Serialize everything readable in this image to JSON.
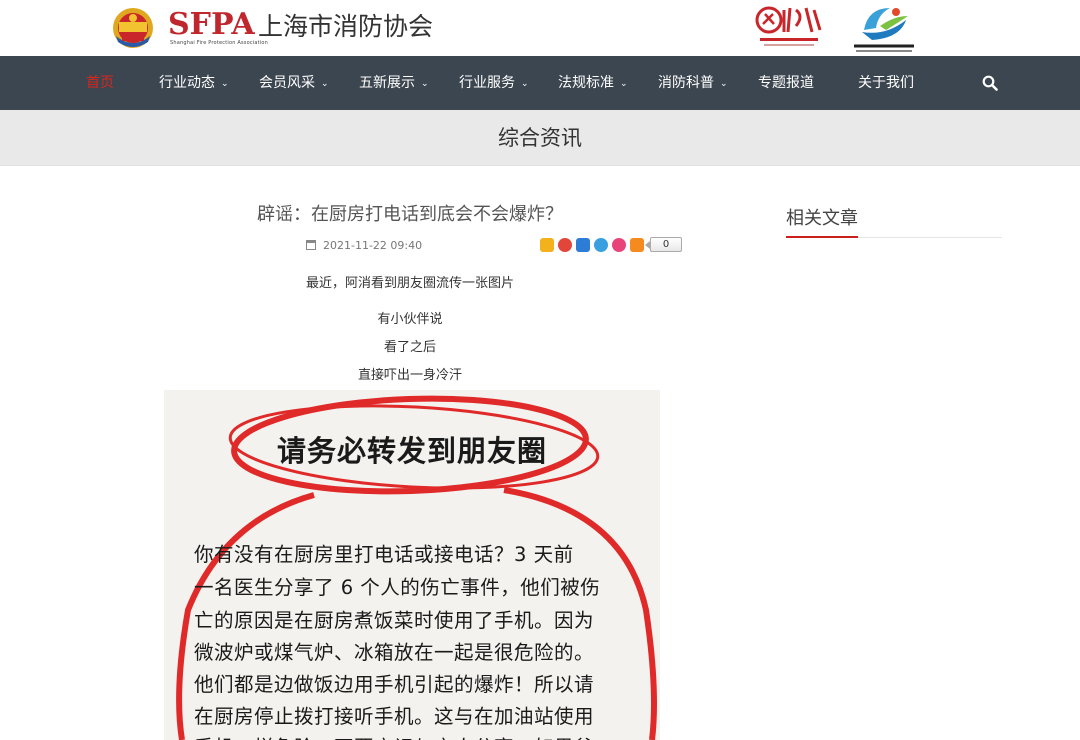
{
  "header": {
    "logo_title": "SFPA",
    "logo_subtitle": "Shanghai Fire Protection Association",
    "logo_cn": "上海市消防协会"
  },
  "nav": {
    "items": [
      {
        "label": "首页",
        "active": true,
        "has_caret": false
      },
      {
        "label": "行业动态",
        "has_caret": true
      },
      {
        "label": "会员风采",
        "has_caret": true
      },
      {
        "label": "五新展示",
        "has_caret": true
      },
      {
        "label": "行业服务",
        "has_caret": true
      },
      {
        "label": "法规标准",
        "has_caret": true
      },
      {
        "label": "消防科普",
        "has_caret": true
      },
      {
        "label": "专题报道",
        "has_caret": false
      },
      {
        "label": "关于我们",
        "has_caret": false
      }
    ],
    "search_icon": "search-icon",
    "active_color": "#d9261c",
    "bar_color": "#3c4650"
  },
  "banner": {
    "title": "综合资讯"
  },
  "article": {
    "title": "辟谣：在厨房打电话到底会不会爆炸？",
    "date": "2021-11-22 09:40",
    "share_count": "0",
    "paragraphs": [
      "最近，阿消看到朋友圈流传一张图片",
      "有小伙伴说",
      "看了之后",
      "直接吓出一身冷汗"
    ],
    "image": {
      "headline": "请务必转发到朋友圈",
      "lines": [
        "你有没有在厨房里打电话或接电话？3 天前",
        "一名医生分享了 6 个人的伤亡事件，他们被伤",
        "亡的原因是在厨房煮饭菜时使用了手机。因为",
        "微波炉或煤气炉、冰箱放在一起是很危险的。",
        "他们都是边做饭边用手机引起的爆炸！所以请",
        "在厨房停止拨打接听手机。这与在加油站使用",
        "手机一样危险，不要忘记与亲人分享，如果爸"
      ]
    }
  },
  "sidebar": {
    "title": "相关文章"
  }
}
